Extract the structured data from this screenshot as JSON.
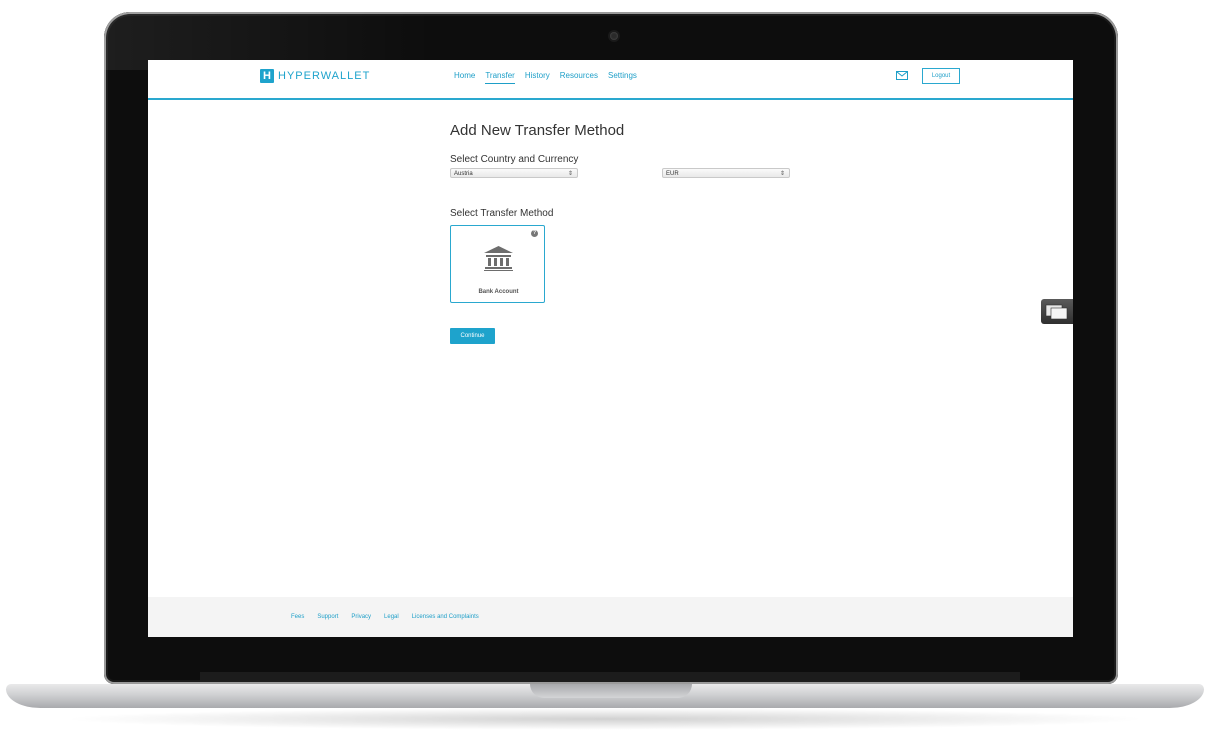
{
  "brand": {
    "logo_letter": "H",
    "name": "HYPERWALLET",
    "accent": "#1ea3cc"
  },
  "nav": {
    "items": [
      {
        "label": "Home",
        "active": false
      },
      {
        "label": "Transfer",
        "active": true
      },
      {
        "label": "History",
        "active": false
      },
      {
        "label": "Resources",
        "active": false
      },
      {
        "label": "Settings",
        "active": false
      }
    ],
    "logout_label": "Logout"
  },
  "main": {
    "title": "Add New Transfer Method",
    "country_heading": "Select Country and Currency",
    "country_value": "Austria",
    "currency_value": "EUR",
    "select_arrow": "⇕",
    "method_heading": "Select Transfer Method",
    "method_card": {
      "label": "Bank Account",
      "icon": "bank-icon",
      "help": "?"
    },
    "continue_label": "Continue"
  },
  "footer": {
    "links": [
      "Fees",
      "Support",
      "Privacy",
      "Legal",
      "Licenses and Complaints"
    ]
  }
}
